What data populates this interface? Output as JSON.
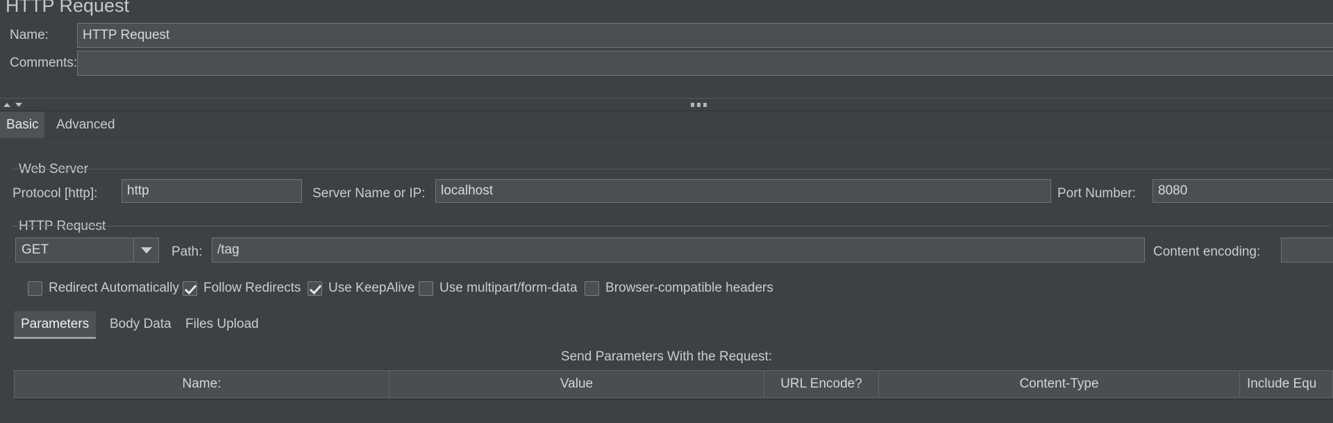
{
  "panel": {
    "title": "HTTP Request"
  },
  "fields": {
    "name_label": "Name:",
    "name_value": "HTTP Request",
    "comments_label": "Comments:",
    "comments_value": ""
  },
  "top_tabs": [
    {
      "label": "Basic",
      "selected": true
    },
    {
      "label": "Advanced",
      "selected": false
    }
  ],
  "web_server": {
    "group_title": "Web Server",
    "protocol_label": "Protocol [http]:",
    "protocol_value": "http",
    "server_label": "Server Name or IP:",
    "server_value": "localhost",
    "port_label": "Port Number:",
    "port_value": "8080"
  },
  "http_request": {
    "group_title": "HTTP Request",
    "method_value": "GET",
    "path_label": "Path:",
    "path_value": "/tag",
    "content_encoding_label": "Content encoding:",
    "content_encoding_value": ""
  },
  "checkboxes": [
    {
      "label": "Redirect Automatically",
      "checked": false
    },
    {
      "label": "Follow Redirects",
      "checked": true
    },
    {
      "label": "Use KeepAlive",
      "checked": true
    },
    {
      "label": "Use multipart/form-data",
      "checked": false
    },
    {
      "label": "Browser-compatible headers",
      "checked": false
    }
  ],
  "inner_tabs": [
    {
      "label": "Parameters",
      "selected": true
    },
    {
      "label": "Body Data",
      "selected": false
    },
    {
      "label": "Files Upload",
      "selected": false
    }
  ],
  "parameters_table": {
    "caption": "Send Parameters With the Request:",
    "columns": [
      "Name:",
      "Value",
      "URL Encode?",
      "Content-Type",
      "Include Equ"
    ],
    "rows": []
  },
  "colors": {
    "background": "#3c4144",
    "field": "#4a4f52",
    "border": "#6e7477",
    "text": "#c9cdd0",
    "selected_tab": "#4d5255"
  }
}
